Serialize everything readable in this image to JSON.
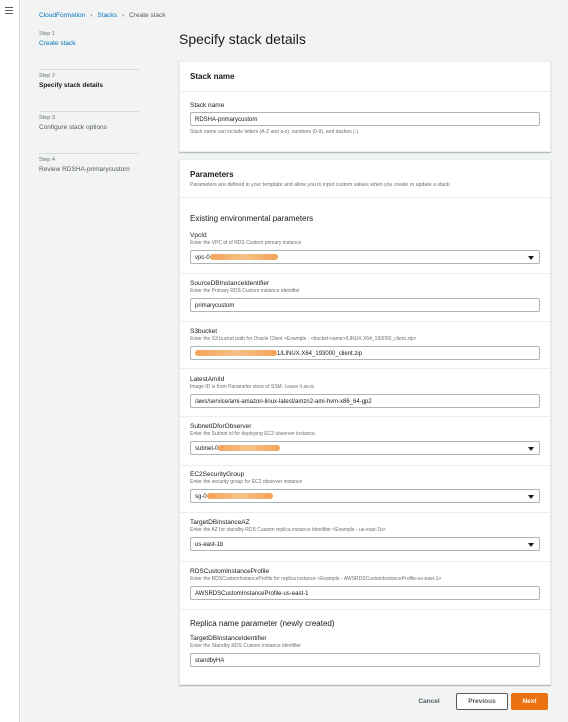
{
  "breadcrumb": [
    "CloudFormation",
    "Stacks",
    "Create stack"
  ],
  "steps": [
    {
      "num": "Step 1",
      "label": "Create stack"
    },
    {
      "num": "Step 2",
      "label": "Specify stack details"
    },
    {
      "num": "Step 3",
      "label": "Configure stack options"
    },
    {
      "num": "Step 4",
      "label": "Review RDSHA-primarycustom"
    }
  ],
  "page_title": "Specify stack details",
  "stack_name_panel": {
    "title": "Stack name",
    "label": "Stack name",
    "value": "RDSHA-primarycustom",
    "desc": "Stack name can include letters (A-Z and a-z), numbers (0-9), and dashes (-)."
  },
  "params_panel": {
    "title": "Parameters",
    "desc": "Parameters are defined in your template and allow you to input custom values when you create or update a stack.",
    "section1": "Existing environmental parameters",
    "section2": "Replica name parameter (newly created)",
    "fields": [
      {
        "label": "VpcId",
        "desc": "Enter the VPC id of RDS Custom primary instance",
        "value": "vpc-0",
        "type": "select"
      },
      {
        "label": "SourceDBInstanceIdentifier",
        "desc": "Enter the Primary RDS Custom instance identifier",
        "value": "primarycustom",
        "type": "text"
      },
      {
        "label": "S3bucket",
        "desc": "Enter the S3 bucket path for Oracle Client <Example - <bucket-name>/LINUX.X64_193000_client.zip>",
        "value": "1/LINUX.X64_193000_client.zip",
        "type": "text"
      },
      {
        "label": "LatestAmiId",
        "desc": "Image ID is from Parameter store of SSM. Leave it as-is.",
        "value": "/aws/service/ami-amazon-linux-latest/amzn2-ami-hvm-x86_64-gp2",
        "type": "text"
      },
      {
        "label": "SubnetIDforObserver",
        "desc": "Enter the Subnet id for deploying EC2 observer instance.",
        "value": "subnet-0",
        "type": "select"
      },
      {
        "label": "EC2SecurityGroup",
        "desc": "Enter the security group for EC2 observer instance",
        "value": "sg-0",
        "type": "select"
      },
      {
        "label": "TargetDBinstanceAZ",
        "desc": "Enter the AZ for standby RDS Custom replica instance identifier <Example - us-east-1b>",
        "value": "us-east-1b",
        "type": "select"
      },
      {
        "label": "RDSCustomInstanceProfile",
        "desc": "Enter the RDSCustomInstanceProfile for replica instance <Example - AWSRDSCustomInstanceProfile-us-east-1>",
        "value": "AWSRDSCustomInstanceProfile-us-east-1",
        "type": "text"
      },
      {
        "label": "TargetDBInstanceIdentifier",
        "desc": "Enter the Standby RDS Custom instance identifier",
        "value": "standbyHA",
        "type": "text"
      }
    ]
  },
  "buttons": {
    "cancel": "Cancel",
    "previous": "Previous",
    "next": "Next"
  },
  "colors": {
    "link": "#0073bb",
    "primary_button": "#ec7211",
    "redaction": "#f2a35a"
  }
}
